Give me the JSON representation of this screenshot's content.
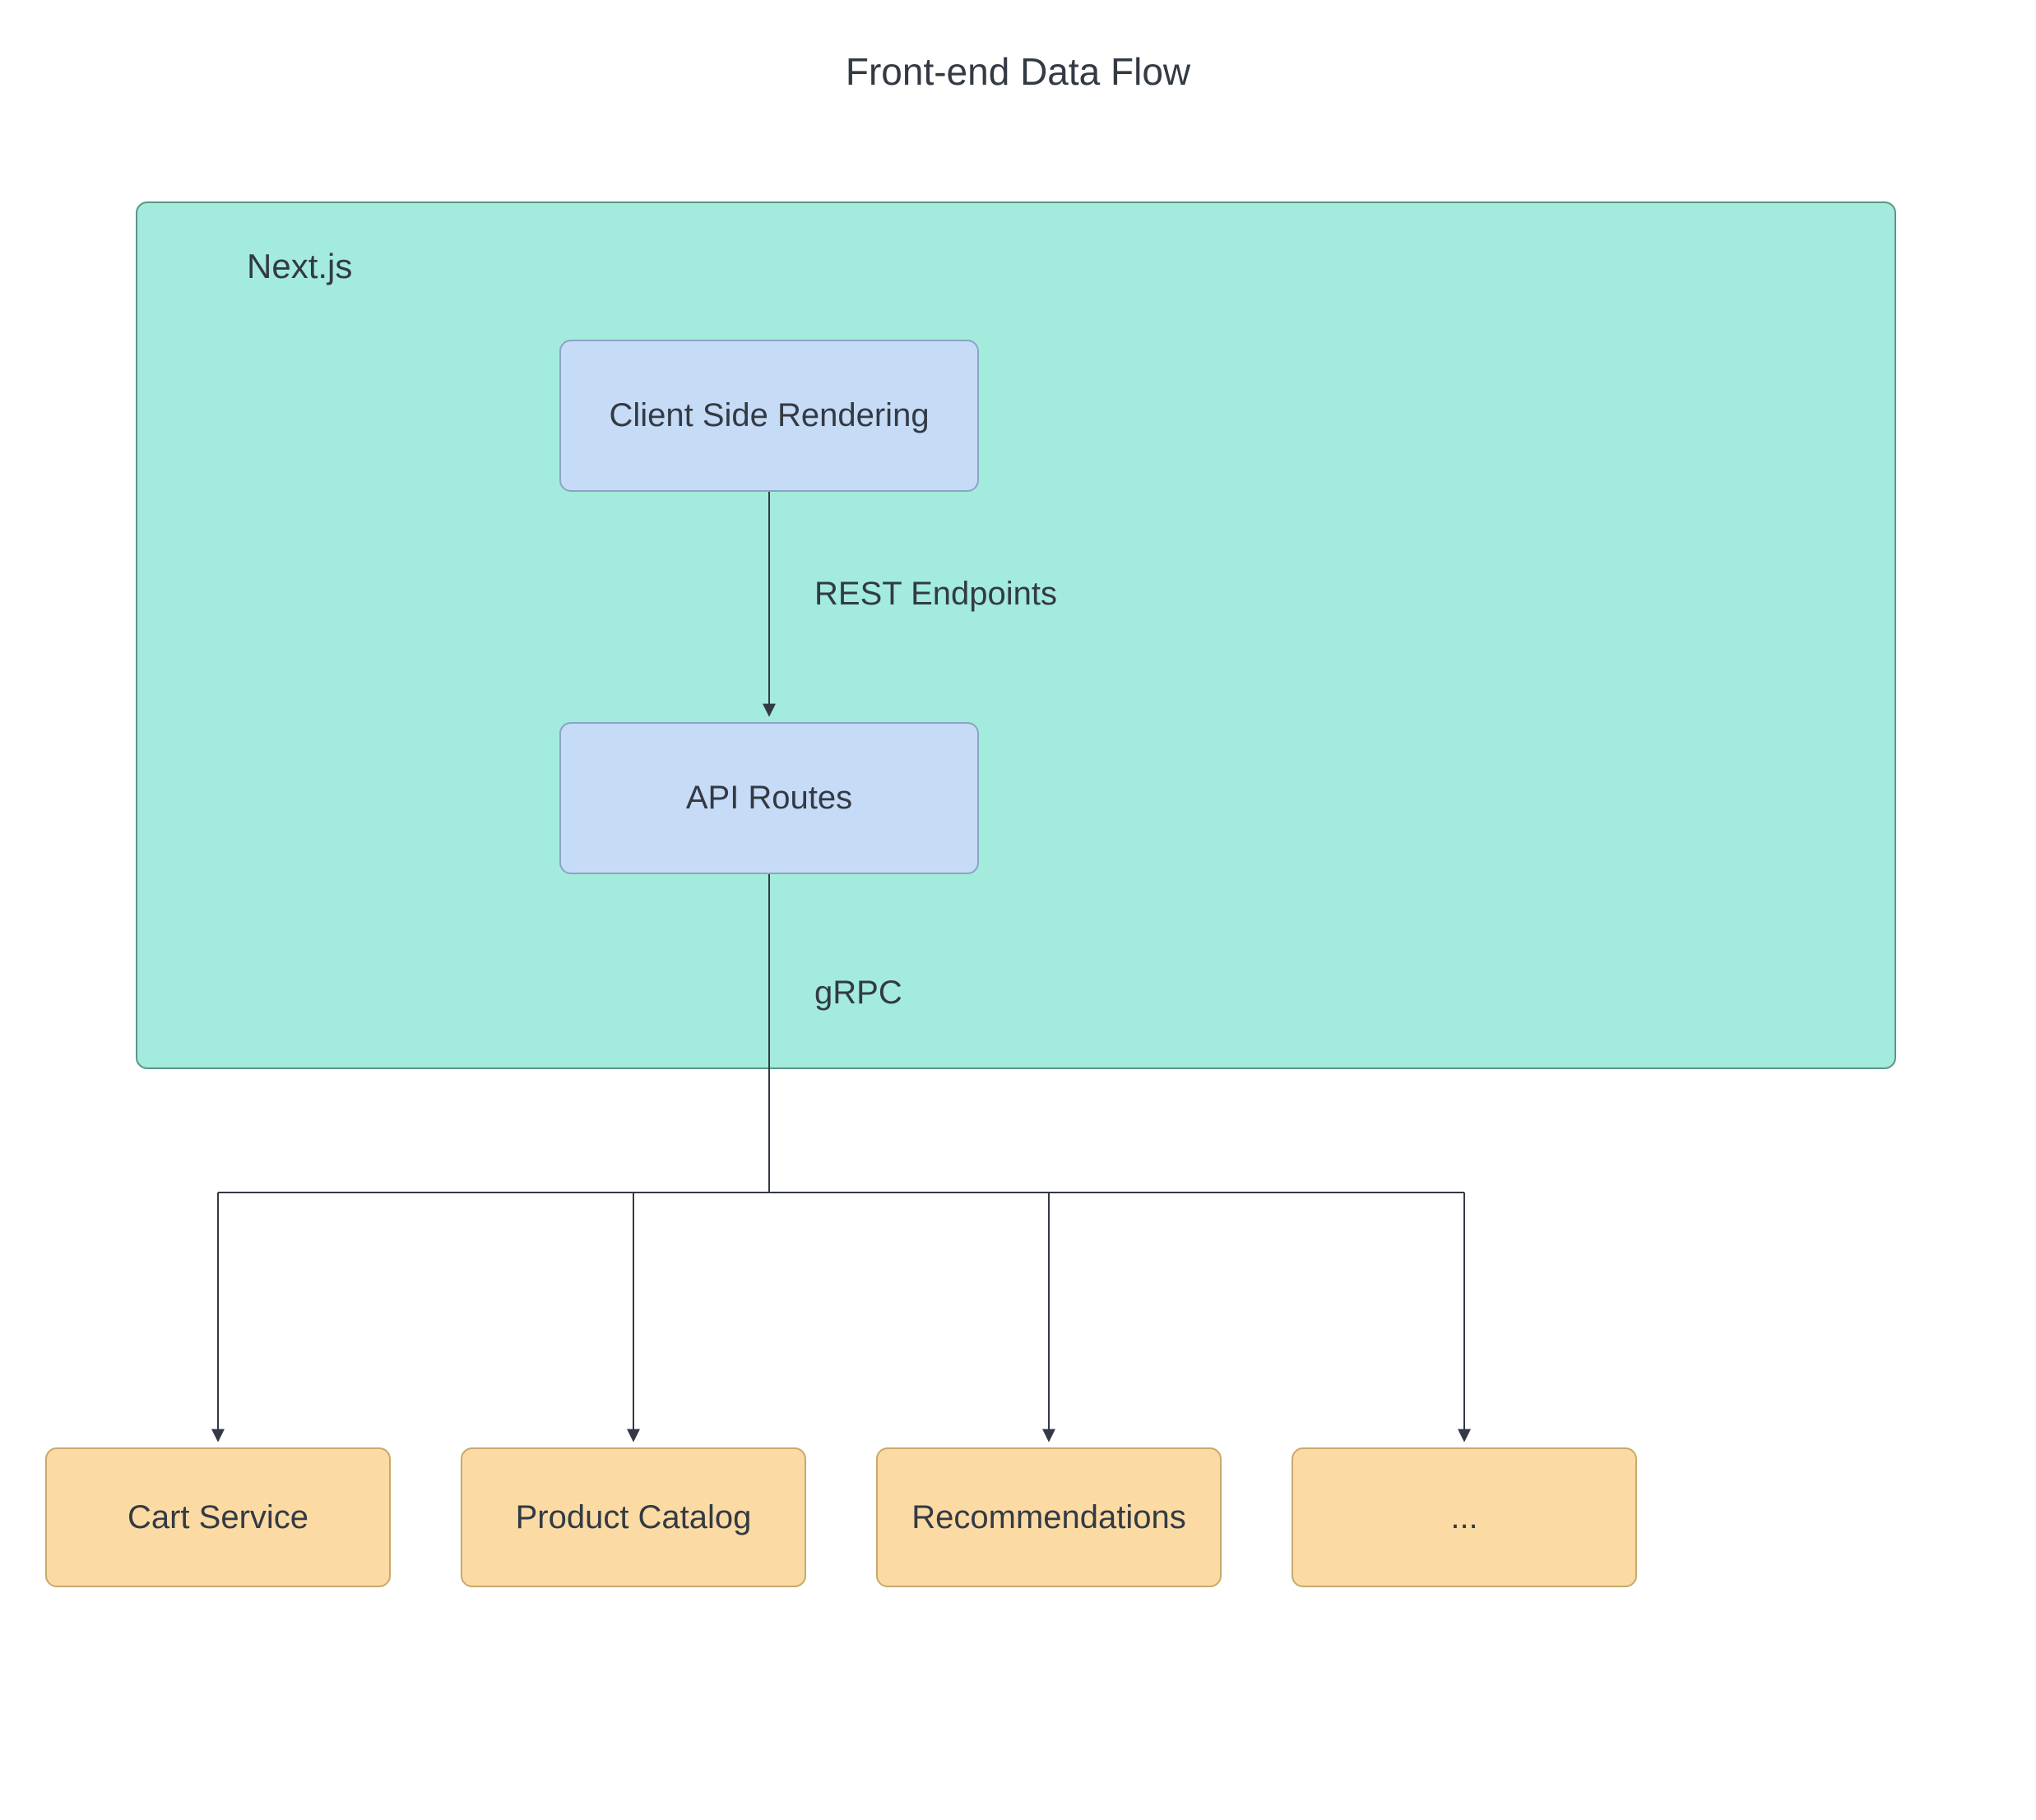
{
  "title": "Front-end Data Flow",
  "container": {
    "label": "Next.js"
  },
  "nodes": {
    "csr": "Client Side Rendering",
    "api": "API Routes",
    "cart": "Cart Service",
    "catalog": "Product Catalog",
    "reco": "Recommendations",
    "more": "..."
  },
  "edges": {
    "rest": "REST Endpoints",
    "grpc": "gRPC"
  },
  "colors": {
    "container_bg": "#a3ebdc",
    "container_border": "#5a968a",
    "node_blue_bg": "#c6dbf6",
    "node_blue_border": "#8aa5c4",
    "node_orange_bg": "#fbdba3",
    "node_orange_border": "#c7a96b",
    "text": "#333a44"
  }
}
